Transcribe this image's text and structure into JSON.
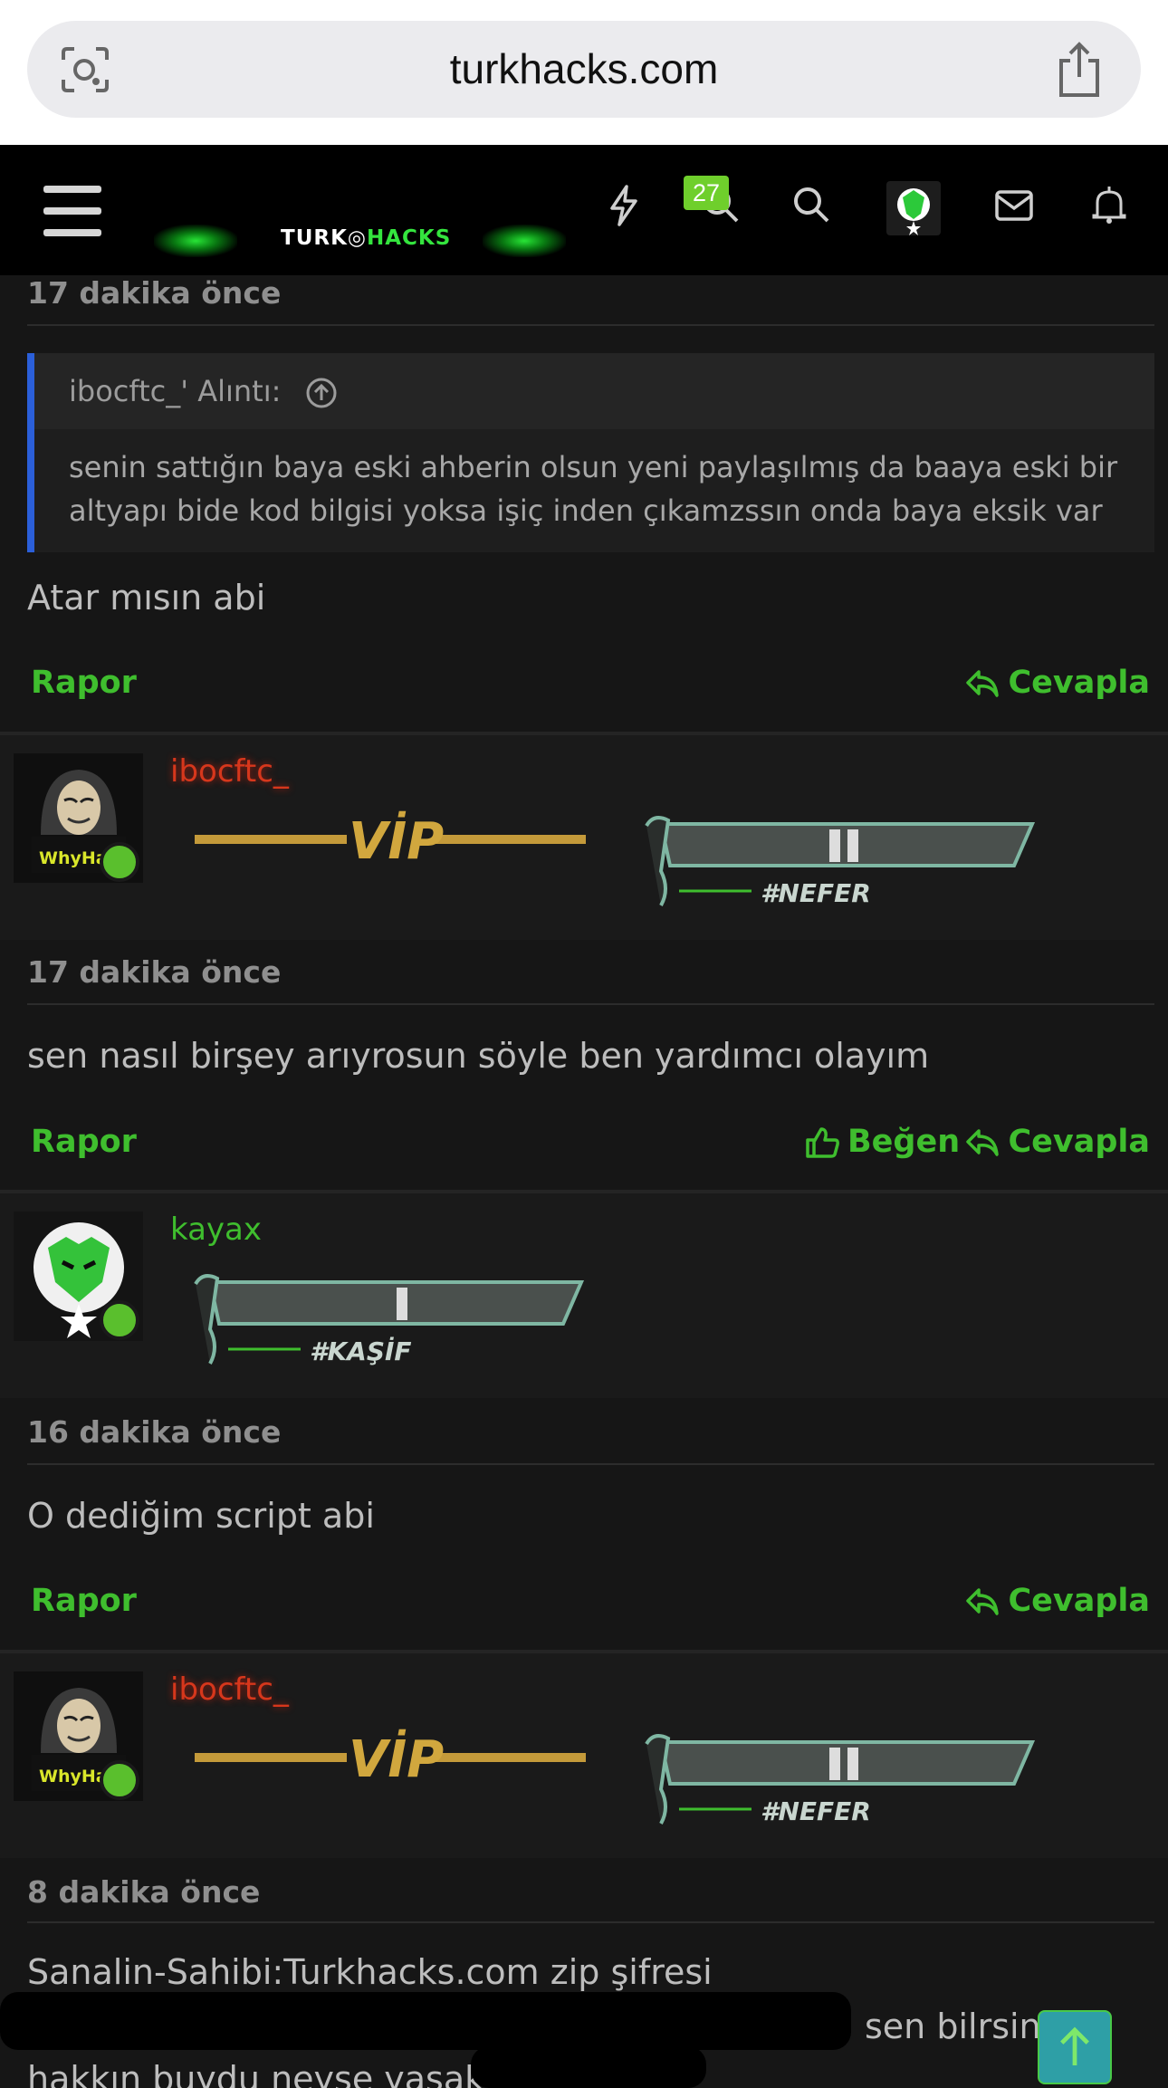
{
  "browser": {
    "domain": "turkhacks.com",
    "icons": {
      "lens": "page-lens-icon",
      "share": "share-icon"
    }
  },
  "header": {
    "logo_text_left": "TURK",
    "logo_text_right": "HACKS",
    "notification_count": "27",
    "icons": [
      "menu-icon",
      "lightning-icon",
      "search-icon",
      "avatar",
      "mail-icon",
      "bell-icon"
    ]
  },
  "posts": [
    {
      "time": "17 dakika önce",
      "quote": {
        "header": "ibocftc_' Alıntı:",
        "body": "senin sattığın baya eski ahberin olsun yeni paylaşılmış da baaya eski bir altyapı bide kod bilgisi yoksa işiç inden çıkamzssın onda baya eksik var"
      },
      "text": "Atar mısın abi",
      "actions": {
        "report": "Rapor",
        "reply": "Cevapla"
      }
    },
    {
      "user": {
        "name": "ibocftc_",
        "avatar_text": "WhyHaci",
        "vip": "VİP",
        "rank": "#NEFER"
      },
      "time": "17 dakika önce",
      "text": "sen nasıl birşey arıyrosun söyle ben yardımcı olayım",
      "actions": {
        "report": "Rapor",
        "like": "Beğen",
        "reply": "Cevapla"
      }
    },
    {
      "user": {
        "name": "kayax",
        "rank": "#KAŞİF"
      },
      "time": "16 dakika önce",
      "text": "O dediğim script abi",
      "actions": {
        "report": "Rapor",
        "reply": "Cevapla"
      }
    },
    {
      "user": {
        "name": "ibocftc_",
        "avatar_text": "WhyHaci",
        "vip": "VİP",
        "rank": "#NEFER"
      },
      "time": "8 dakika önce",
      "text_line1": "Sanalin-Sahibi:Turkhacks.com zip şifresi",
      "text_line2_end": "sen bilrsin tek",
      "text_line3": "hakkın buydu neyse yasak normalde"
    }
  ],
  "colors": {
    "accent_green": "#3fbe2e",
    "vip_red": "#d6371c",
    "quote_bar": "#2b5fd9",
    "background": "#161616"
  }
}
